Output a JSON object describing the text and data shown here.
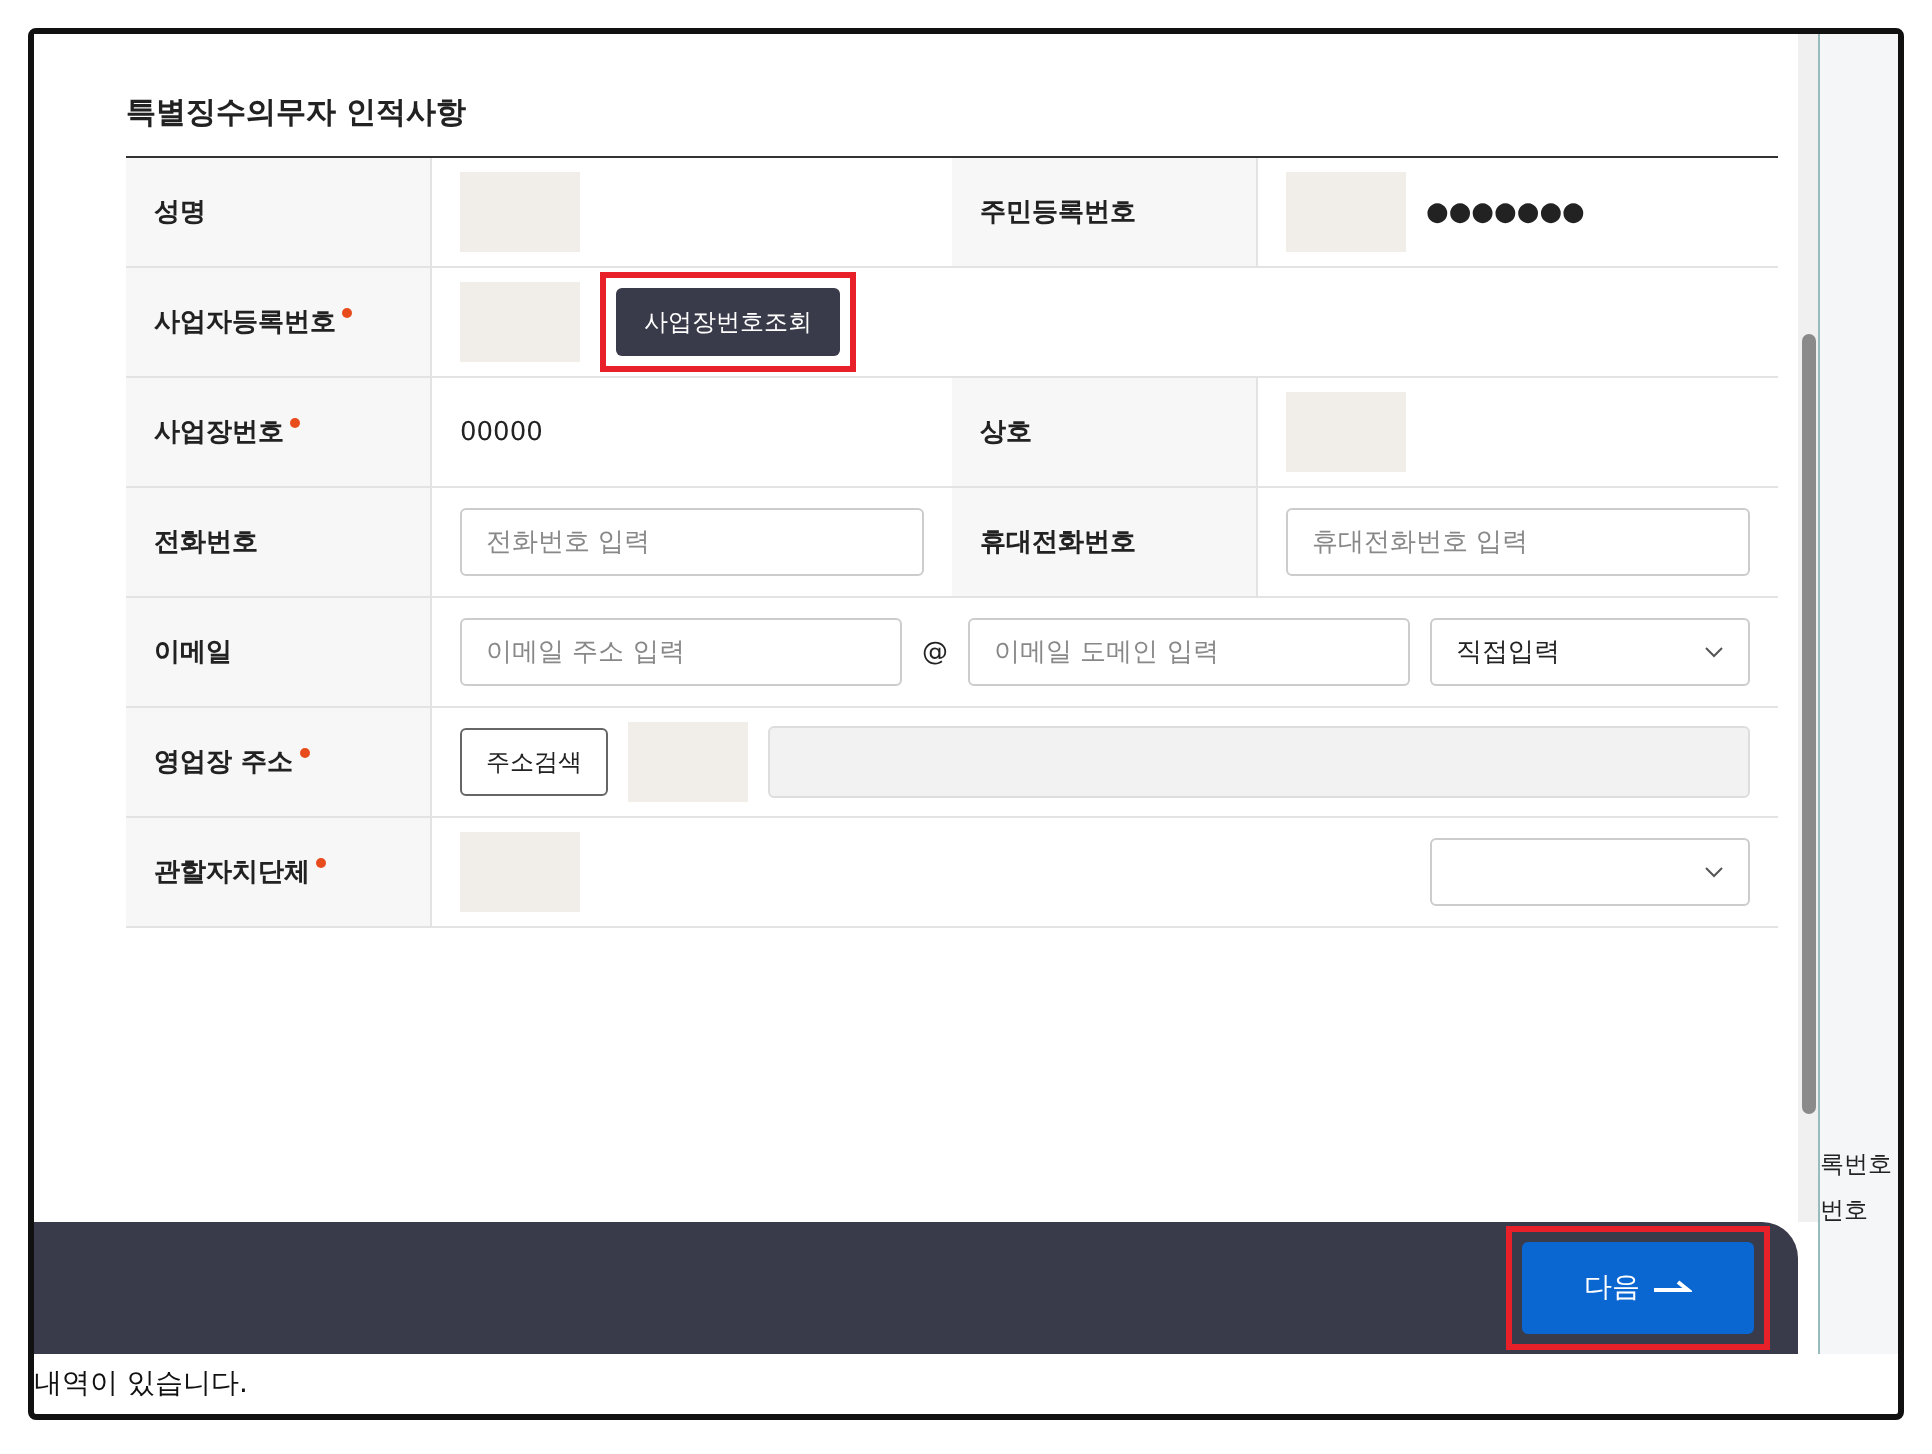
{
  "section_title": "특별징수의무자 인적사항",
  "rows": [
    {
      "cells": [
        {
          "label": "성명",
          "required": false,
          "parts": [
            {
              "kind": "redacted"
            }
          ]
        },
        {
          "label": "주민등록번호",
          "required": false,
          "parts": [
            {
              "kind": "redacted"
            },
            {
              "kind": "text",
              "text": "●●●●●●●"
            }
          ]
        }
      ]
    },
    {
      "cells": [
        {
          "label": "사업자등록번호",
          "required": true,
          "parts": [
            {
              "kind": "redacted"
            },
            {
              "kind": "button",
              "text": "사업장번호조회",
              "highlighted": true
            }
          ]
        }
      ]
    },
    {
      "cells": [
        {
          "label": "사업장번호",
          "required": true,
          "parts": [
            {
              "kind": "text",
              "text": "00000"
            }
          ]
        },
        {
          "label": "상호",
          "required": false,
          "parts": [
            {
              "kind": "redacted"
            }
          ]
        }
      ]
    },
    {
      "cells": [
        {
          "label": "전화번호",
          "required": false,
          "parts": [
            {
              "kind": "input",
              "placeholder": "전화번호 입력"
            }
          ]
        },
        {
          "label": "휴대전화번호",
          "required": false,
          "parts": [
            {
              "kind": "input",
              "placeholder": "휴대전화번호 입력"
            }
          ]
        }
      ]
    },
    {
      "cells": [
        {
          "label": "이메일",
          "required": false,
          "parts": [
            {
              "kind": "input",
              "placeholder": "이메일 주소 입력"
            },
            {
              "kind": "text",
              "text": "@"
            },
            {
              "kind": "input",
              "placeholder": "이메일 도메인 입력"
            },
            {
              "kind": "select",
              "text": "직접입력"
            }
          ]
        }
      ]
    },
    {
      "cells": [
        {
          "label": "영업장 주소",
          "required": true,
          "parts": [
            {
              "kind": "outline_button",
              "text": "주소검색"
            },
            {
              "kind": "redacted"
            },
            {
              "kind": "readonly"
            }
          ]
        }
      ]
    },
    {
      "cells": [
        {
          "label": "관할자치단체",
          "required": true,
          "parts": [
            {
              "kind": "redacted"
            },
            {
              "kind": "select"
            }
          ]
        }
      ]
    }
  ],
  "footer": {
    "next_button": {
      "text": "다음",
      "highlighted": true
    }
  },
  "background_texts": [
    "록번호",
    "번호"
  ],
  "bottom_text": "내역이 있습니다."
}
